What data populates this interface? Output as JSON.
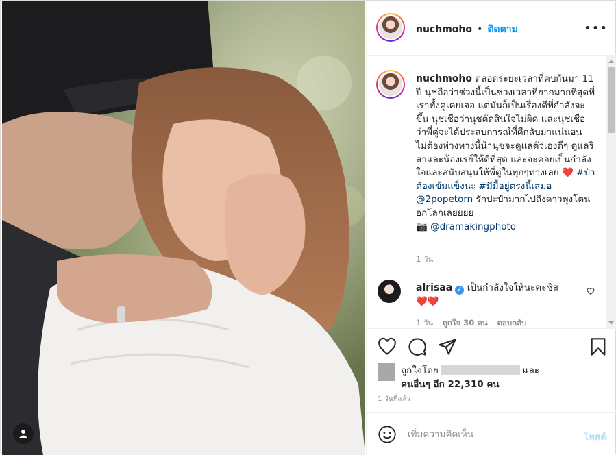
{
  "header": {
    "username": "nuchmoho",
    "separator": "•",
    "follow_label": "ติดตาม",
    "more_icon": "more-horizontal-icon"
  },
  "caption": {
    "username": "nuchmoho",
    "text_part1": "ตลอดระยะเวลาที่คบกันมา 11 ปี นุชถือว่าช่วงนี้เป็นช่วงเวลาที่ยากมากที่สุดที่เราทั้งคู่เคยเจอ แต่มันก็เป็นเรื่องดีที่กำลังจะขึ้น นุชเชื่อว่านุชตัดสินใจไม่ผิด และนุชเชื่อว่าพี่ตู่จะได้ประสบการณ์ที่ดีกลับมาแน่นอน ไม่ต้องห่วงทางนี้น้านุชจะดูแลตัวเองดีๆ ดูแลริสาและน้องเรย์ให้ดีที่สุด และจะคอยเป็นกำลังใจและสนับสนุนให้พี่ตู่ในทุกๆทางเลย",
    "heart_emoji": "❤️",
    "hashtag1": "#ป๋าต้องเข้มแข็งนะ",
    "hashtag2": "#มีมื้อยู่ตรงนี้เสมอ",
    "mention1": "@2popetorn",
    "text_part2": "รักปะป๋ามากไปถึงดาวพุงโตนอกโลกเลยยยย",
    "camera_emoji": "📷",
    "mention2": "@dramakingphoto",
    "time_ago": "1 วัน"
  },
  "comment": {
    "username": "alrisaa",
    "text": "เป็นกำลังใจให้นะคะซิส",
    "hearts": "❤️❤️",
    "time": "1 วัน",
    "likes": "ถูกใจ 30 คน",
    "reply": "ตอบกลับ"
  },
  "actions": {
    "like_icon": "heart-icon",
    "comment_icon": "comment-icon",
    "share_icon": "send-icon",
    "save_icon": "bookmark-icon"
  },
  "likes": {
    "prefix": "ถูกใจโดย",
    "and": "และ",
    "others": "คนอื่นๆ อีก 22,310 คน"
  },
  "date": "1 วันที่แล้ว",
  "composer": {
    "placeholder": "เพิ่มความคิดเห็น",
    "post_label": "โพสต์"
  },
  "colors": {
    "link": "#00376b",
    "follow": "#0095f6",
    "muted": "#8e8e8e",
    "post_disabled": "#b2dffc"
  }
}
